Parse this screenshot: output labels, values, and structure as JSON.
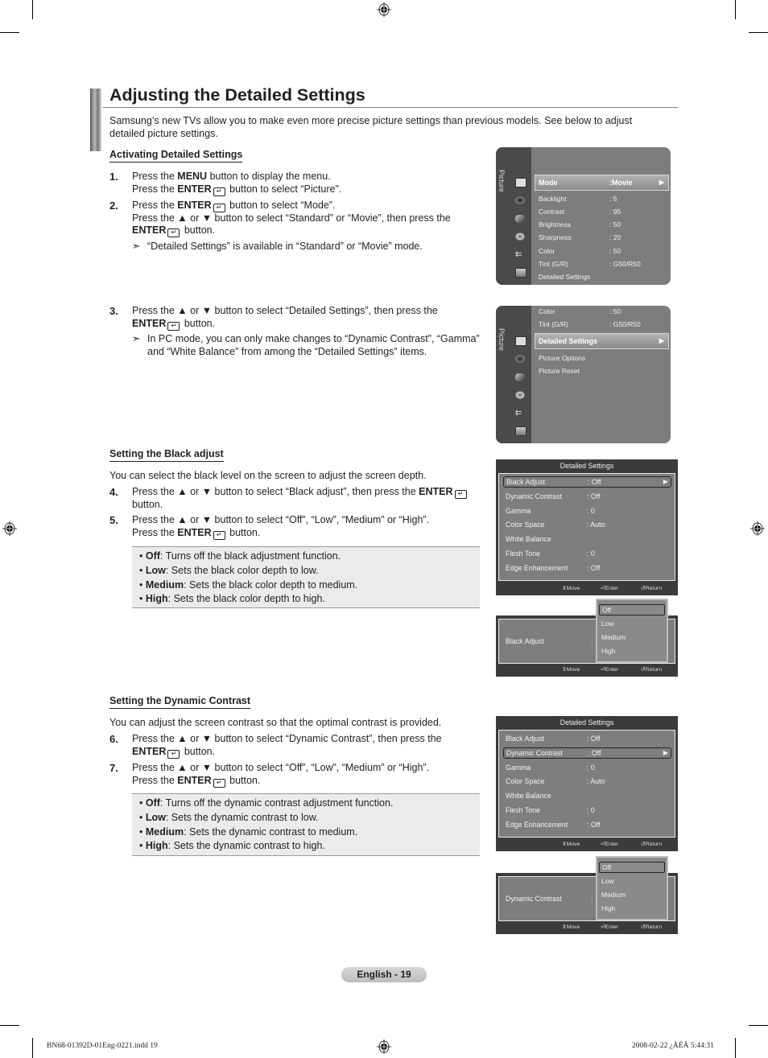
{
  "page": {
    "title": "Adjusting the Detailed Settings",
    "intro": "Samsung’s new TVs allow you to make even more precise picture settings than previous models. See below to adjust detailed picture settings."
  },
  "sections": {
    "activating": {
      "heading": "Activating Detailed Settings",
      "step1": {
        "num": "1.",
        "l1a": "Press the ",
        "l1b": "MENU",
        "l1c": " button to display the menu.",
        "l2a": "Press the ",
        "l2b": "ENTER",
        "l2c": " button to select “Picture”."
      },
      "step2": {
        "num": "2.",
        "l1a": "Press the ",
        "l1b": "ENTER",
        "l1c": " button to select “Mode”.",
        "l2": "Press the ▲ or ▼ button to select “Standard” or “Movie”, then press the",
        "l3b": "ENTER",
        "l3c": " button."
      },
      "note2": "“Detailed Settings” is available in “Standard” or “Movie” mode.",
      "step3": {
        "num": "3.",
        "l1": "Press the ▲ or ▼ button to select “Detailed Settings”, then press the",
        "l2b": "ENTER",
        "l2c": " button."
      },
      "note3": "In PC mode, you can only make changes to “Dynamic Contrast”, “Gamma” and “White Balance” from among the “Detailed Settings” items."
    },
    "black": {
      "heading": "Setting the Black adjust",
      "para": "You can select the black level on the screen to adjust the screen depth.",
      "step4": {
        "num": "4.",
        "l1a": "Press the ▲ or ▼ button to select “Black adjust”, then press the ",
        "l1b": "ENTER",
        "l2": "button."
      },
      "step5": {
        "num": "5.",
        "l1": "Press the ▲ or ▼ button to select “Off”, “Low”, “Medium” or “High”.",
        "l2a": "Press the ",
        "l2b": "ENTER",
        "l2c": " button."
      },
      "bullets": [
        {
          "term": "Off",
          "desc": ": Turns off the black adjustment function."
        },
        {
          "term": "Low",
          "desc": ": Sets the black color depth to low."
        },
        {
          "term": "Medium",
          "desc": ": Sets the black color depth to medium."
        },
        {
          "term": "High",
          "desc": ": Sets the black color depth to high."
        }
      ]
    },
    "dynamic": {
      "heading": "Setting the Dynamic Contrast",
      "para": "You can adjust the screen contrast so that the optimal contrast is provided.",
      "step6": {
        "num": "6.",
        "l1": "Press the ▲ or ▼ button to select “Dynamic Contrast”, then press the",
        "l2b": "ENTER",
        "l2c": " button."
      },
      "step7": {
        "num": "7.",
        "l1": "Press the ▲ or ▼ button to select “Off”, “Low”, “Medium” or “High”.",
        "l2a": "Press the ",
        "l2b": "ENTER",
        "l2c": " button."
      },
      "bullets": [
        {
          "term": "Off",
          "desc": ": Turns off the dynamic contrast adjustment function."
        },
        {
          "term": "Low",
          "desc": ": Sets the dynamic contrast to low."
        },
        {
          "term": "Medium",
          "desc": ": Sets the dynamic contrast to medium."
        },
        {
          "term": "High",
          "desc": ": Sets the dynamic contrast to high."
        }
      ]
    }
  },
  "menu1": {
    "side_label": "Picture",
    "selected": {
      "label": "Mode",
      "value": ":Movie"
    },
    "items": [
      {
        "label": "Backlight",
        "value": ": 5"
      },
      {
        "label": "Contrast",
        "value": ": 95"
      },
      {
        "label": "Brightness",
        "value": ": 50"
      },
      {
        "label": "Sharpness",
        "value": ": 20"
      },
      {
        "label": "Color",
        "value": ": 50"
      },
      {
        "label": "Tint (G/R)",
        "value": ": G50/R50"
      },
      {
        "label": "Detailed Settings",
        "value": ""
      }
    ]
  },
  "menu2": {
    "side_label": "Picture",
    "above": [
      {
        "label": "Color",
        "value": ": 50"
      },
      {
        "label": "Tint (G/R)",
        "value": ": G50/R50"
      }
    ],
    "selected": {
      "label": "Detailed Settings"
    },
    "below": [
      {
        "label": "Picture Options"
      },
      {
        "label": "Picture Reset"
      }
    ]
  },
  "detailed": {
    "header": "Detailed Settings",
    "items": [
      {
        "label": "Black Adjust",
        "value": ": Off"
      },
      {
        "label": "Dynamic Contrast",
        "value": ": Off"
      },
      {
        "label": "Gamma",
        "value": ": 0"
      },
      {
        "label": "Color Space",
        "value": ": Auto"
      },
      {
        "label": "White Balance",
        "value": ""
      },
      {
        "label": "Flesh Tone",
        "value": ": 0"
      },
      {
        "label": "Edge Enhancement",
        "value": ": Off"
      }
    ],
    "footer": {
      "move": "Move",
      "enter": "Enter",
      "return": "Return"
    }
  },
  "popup_black": {
    "label": "Black Adjust",
    "colon": ":",
    "options": [
      "Off",
      "Low",
      "Medium",
      "High"
    ],
    "selected": "Off"
  },
  "popup_dynamic": {
    "label": "Dynamic Contrast",
    "colon": ":",
    "options": [
      "Off",
      "Low",
      "Medium",
      "High"
    ],
    "selected": "Off"
  },
  "footer": {
    "page_label": "English - 19",
    "file": "BN68-01392D-01Eng-0221.indd   19",
    "timestamp": "2008-02-22   ¿ÀÈÄ 5:44:31"
  },
  "colors": {
    "menu_bg": "#7d7d7d",
    "menu_side": "#4a4a4a",
    "panel_dark": "#3b3b3b",
    "box_bg": "#ebebeb"
  }
}
